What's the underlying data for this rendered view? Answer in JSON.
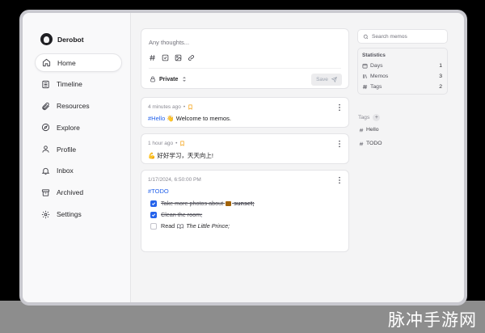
{
  "profile": {
    "name": "Derobot"
  },
  "nav": {
    "items": [
      {
        "label": "Home",
        "icon": "home-icon"
      },
      {
        "label": "Timeline",
        "icon": "timeline-icon"
      },
      {
        "label": "Resources",
        "icon": "paperclip-icon"
      },
      {
        "label": "Explore",
        "icon": "compass-icon"
      },
      {
        "label": "Profile",
        "icon": "user-icon"
      },
      {
        "label": "Inbox",
        "icon": "bell-icon"
      },
      {
        "label": "Archived",
        "icon": "archive-icon"
      },
      {
        "label": "Settings",
        "icon": "gear-icon"
      }
    ],
    "active": "Home"
  },
  "editor": {
    "placeholder": "Any thoughts...",
    "tools": [
      "hash-icon",
      "checkbox-icon",
      "image-icon",
      "link-icon"
    ],
    "visibility": "Private",
    "save_label": "Save"
  },
  "memos": [
    {
      "time": "4 minutes ago",
      "tag": "#Hello",
      "text": "👋 Welcome to memos."
    },
    {
      "time": "1 hour ago",
      "text": "💪 好好学习，天天向上!"
    },
    {
      "time": "1/17/2024, 6:50:00 PM",
      "tag": "#TODO",
      "tasks": [
        {
          "label_before": "Take more photos about",
          "label_after": "sunset;",
          "done": true
        },
        {
          "label": "Clean the room;",
          "done": true
        },
        {
          "label_before": "Read",
          "label_after": "The Little Prince;",
          "done": false
        }
      ]
    }
  ],
  "search": {
    "placeholder": "Search memos"
  },
  "statistics": {
    "title": "Statistics",
    "rows": [
      {
        "label": "Days",
        "value": "1",
        "icon": "calendar-icon"
      },
      {
        "label": "Memos",
        "value": "3",
        "icon": "library-icon"
      },
      {
        "label": "Tags",
        "value": "2",
        "icon": "hash-icon"
      }
    ]
  },
  "tags": {
    "title": "Tags",
    "items": [
      "Hello",
      "TODO"
    ]
  },
  "watermark": "脉冲手游网",
  "colors": {
    "accent": "#2563eb",
    "background": "#f4f4f5",
    "card": "#ffffff",
    "pin": "#f59e0b"
  }
}
